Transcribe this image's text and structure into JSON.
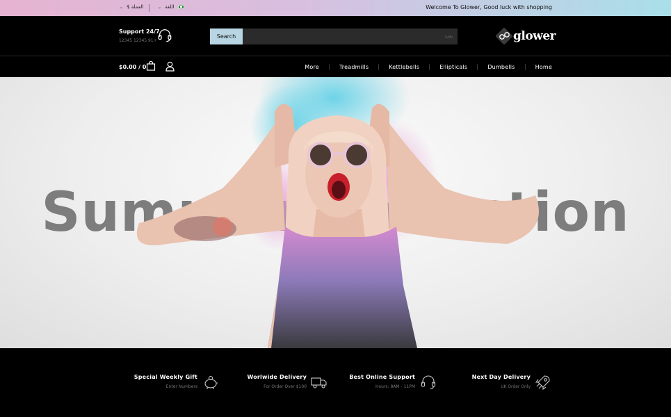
{
  "topbar": {
    "currency_label": "$ العملة",
    "language_label": "اللغة",
    "welcome": "Welcome To Glower, Good luck with shopping"
  },
  "header": {
    "support_title": "Support 24/7",
    "support_phone": "12345 12345 91+",
    "search_button": "Search",
    "search_placeholder": "بحث",
    "logo_text": "glower"
  },
  "nav": {
    "cart_total": "$0.00 / 0",
    "menu": [
      "More",
      "Treadmills",
      "Kettlebells",
      "Ellipticals",
      "Dumbells",
      "Home"
    ]
  },
  "hero": {
    "headline": "Summer Collection"
  },
  "features": [
    {
      "title": "Special Weekly Gift",
      "subtitle": "Enter Numbers",
      "icon": "piggy-bank-icon"
    },
    {
      "title": "Worlwide Delivery",
      "subtitle": "For Order Over $100",
      "icon": "delivery-truck-icon"
    },
    {
      "title": "Best Online Support",
      "subtitle": "Hours: 8AM - 11PM",
      "icon": "headset-icon"
    },
    {
      "title": "Next Day Delivery",
      "subtitle": "UK Order Only",
      "icon": "rocket-icon"
    }
  ],
  "colors": {
    "accent": "#b8d5e3",
    "topbar_left": "#e6b3d1",
    "topbar_right": "#a9dfe9",
    "background": "#000000"
  }
}
